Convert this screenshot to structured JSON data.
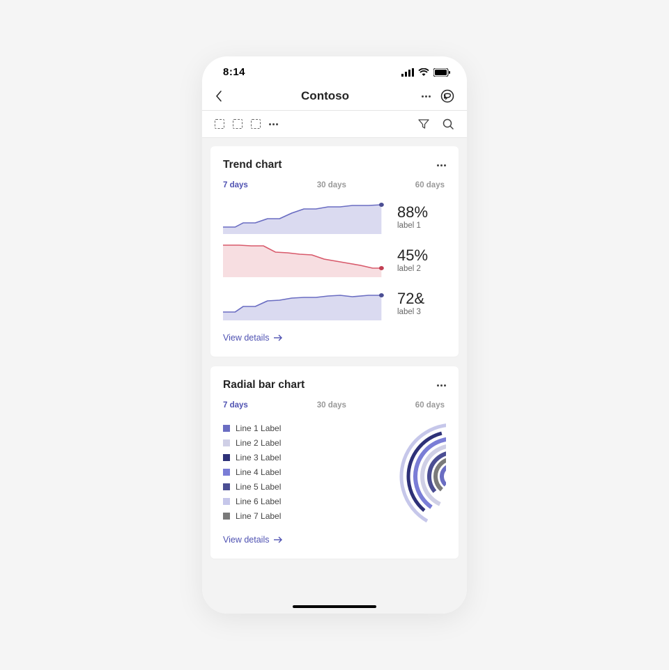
{
  "status": {
    "time": "8:14"
  },
  "header": {
    "title": "Contoso"
  },
  "tabs": {
    "t7": "7 days",
    "t30": "30 days",
    "t60": "60 days"
  },
  "view_details": "View details",
  "trend_card": {
    "title": "Trend chart",
    "rows": [
      {
        "value": "88%",
        "label": "label 1"
      },
      {
        "value": "45%",
        "label": "label 2"
      },
      {
        "value": "72&",
        "label": "label 3"
      }
    ]
  },
  "radial_card": {
    "title": "Radial bar chart",
    "legend": [
      {
        "color": "#6a6dc2",
        "label": "Line 1 Label"
      },
      {
        "color": "#cfcfe6",
        "label": "Line 2 Label"
      },
      {
        "color": "#2e3178",
        "label": "Line 3 Label"
      },
      {
        "color": "#7a7dd6",
        "label": "Line 4 Label"
      },
      {
        "color": "#4b4e93",
        "label": "Line 5 Label"
      },
      {
        "color": "#c6c7ea",
        "label": "Line 6 Label"
      },
      {
        "color": "#7a7a7a",
        "label": "Line 7 Label"
      }
    ]
  },
  "colors": {
    "purple": "#6a6dc2",
    "purpleFill": "rgba(106,109,194,0.25)",
    "red": "#d85a6b",
    "redFill": "rgba(216,90,107,0.20)"
  },
  "chart_data": [
    {
      "type": "area",
      "title": "Trend chart — series 1",
      "x": [
        0,
        1,
        2,
        3,
        4,
        5,
        6,
        7,
        8,
        9,
        10,
        11,
        12,
        13
      ],
      "values": [
        22,
        22,
        30,
        30,
        40,
        40,
        55,
        72,
        72,
        80,
        80,
        85,
        85,
        88
      ],
      "ylim": [
        0,
        100
      ],
      "summary_value": 88,
      "summary_label": "label 1",
      "color": "#6a6dc2"
    },
    {
      "type": "area",
      "title": "Trend chart — series 2",
      "x": [
        0,
        1,
        2,
        3,
        4,
        5,
        6,
        7,
        8,
        9,
        10,
        11,
        12,
        13
      ],
      "values": [
        95,
        95,
        94,
        94,
        80,
        78,
        75,
        73,
        65,
        60,
        55,
        50,
        45,
        45
      ],
      "ylim": [
        0,
        100
      ],
      "summary_value": 45,
      "summary_label": "label 2",
      "color": "#d85a6b"
    },
    {
      "type": "area",
      "title": "Trend chart — series 3",
      "x": [
        0,
        1,
        2,
        3,
        4,
        5,
        6,
        7,
        8,
        9,
        10,
        11,
        12,
        13
      ],
      "values": [
        28,
        28,
        40,
        40,
        55,
        58,
        62,
        65,
        65,
        70,
        72,
        70,
        72,
        72
      ],
      "ylim": [
        0,
        100
      ],
      "summary_value": 72,
      "summary_label": "label 3",
      "color": "#6a6dc2"
    },
    {
      "type": "radial-bar",
      "title": "Radial bar chart",
      "series": [
        {
          "name": "Line 1 Label",
          "value": 35,
          "color": "#6a6dc2"
        },
        {
          "name": "Line 2 Label",
          "value": 60,
          "color": "#cfcfe6"
        },
        {
          "name": "Line 3 Label",
          "value": 45,
          "color": "#2e3178"
        },
        {
          "name": "Line 4 Label",
          "value": 50,
          "color": "#7a7dd6"
        },
        {
          "name": "Line 5 Label",
          "value": 30,
          "color": "#4b4e93"
        },
        {
          "name": "Line 6 Label",
          "value": 55,
          "color": "#c6c7ea"
        },
        {
          "name": "Line 7 Label",
          "value": 40,
          "color": "#7a7a7a"
        }
      ],
      "max": 100
    }
  ]
}
